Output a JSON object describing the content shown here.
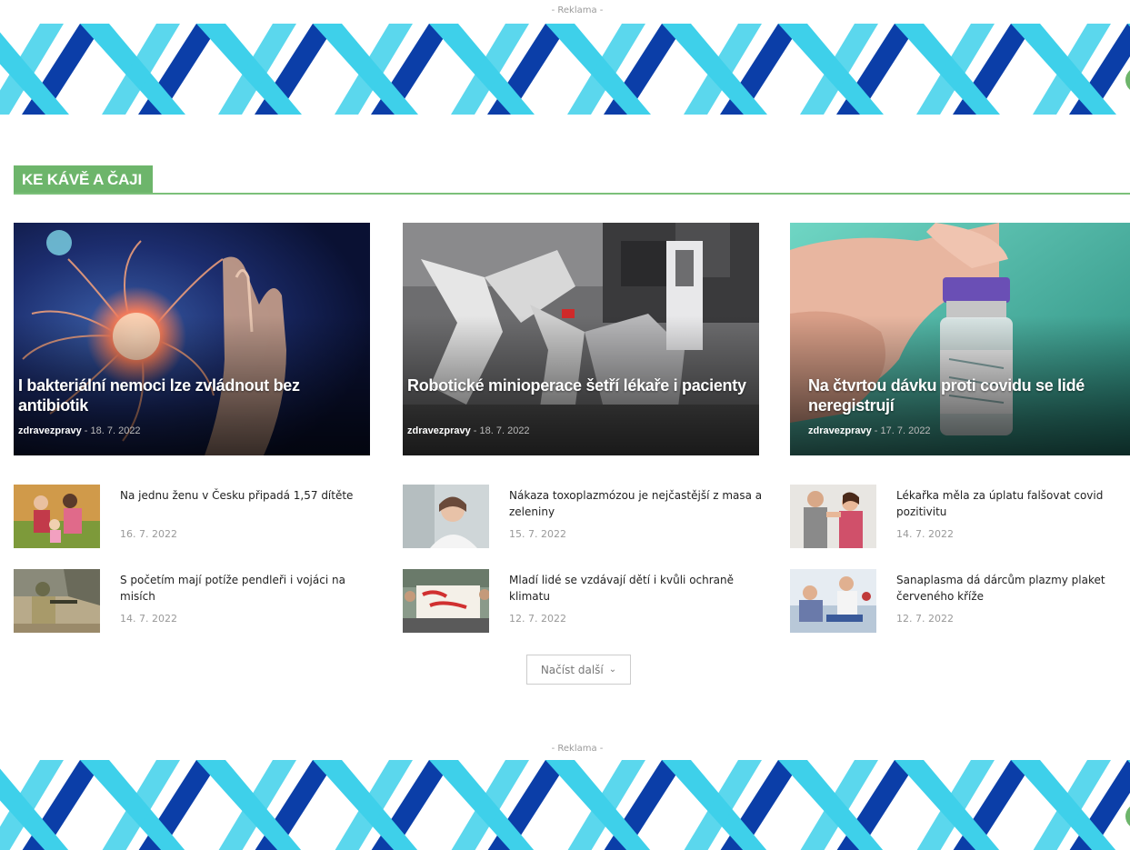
{
  "ads": {
    "top_label": "- Reklama -",
    "bottom_label": "- Reklama -"
  },
  "section": {
    "title": "KE KÁVĚ A ČAJI"
  },
  "featured": [
    {
      "title": "I bakteriální nemoci lze zvládnout bez antibiotik",
      "author": "zdravezpravy",
      "separator": " - ",
      "date": "18. 7. 2022"
    },
    {
      "title": "Robotické minioperace šetří lékaře i pacienty",
      "author": "zdravezpravy",
      "separator": " - ",
      "date": "18. 7. 2022"
    },
    {
      "title": "Na čtvrtou dávku proti covidu se lidé neregistrují",
      "author": "zdravezpravy",
      "separator": " - ",
      "date": "17. 7. 2022"
    }
  ],
  "articles": [
    {
      "title": "Na jednu ženu v Česku připadá 1,57 dítěte",
      "date": "16. 7. 2022"
    },
    {
      "title": "Nákaza toxoplazmózou je nejčastější z masa a zeleniny",
      "date": "15. 7. 2022"
    },
    {
      "title": "Lékařka měla za úplatu falšovat covid pozitivitu",
      "date": "14. 7. 2022"
    },
    {
      "title": "S početím mají potíže pendleři i vojáci na misích",
      "date": "14. 7. 2022"
    },
    {
      "title": "Mladí lidé se vzdávají dětí i kvůli ochraně klimatu",
      "date": "12. 7. 2022"
    },
    {
      "title": "Sanaplasma dá dárcům plazmy plaket červeného kříže",
      "date": "12. 7. 2022"
    }
  ],
  "load_more": {
    "label": "Načíst další",
    "icon": "chevron-down-icon"
  },
  "colors": {
    "accent_green": "#6db56b",
    "dna_light": "#3ed0ea",
    "dna_dark": "#0b3ea8"
  }
}
